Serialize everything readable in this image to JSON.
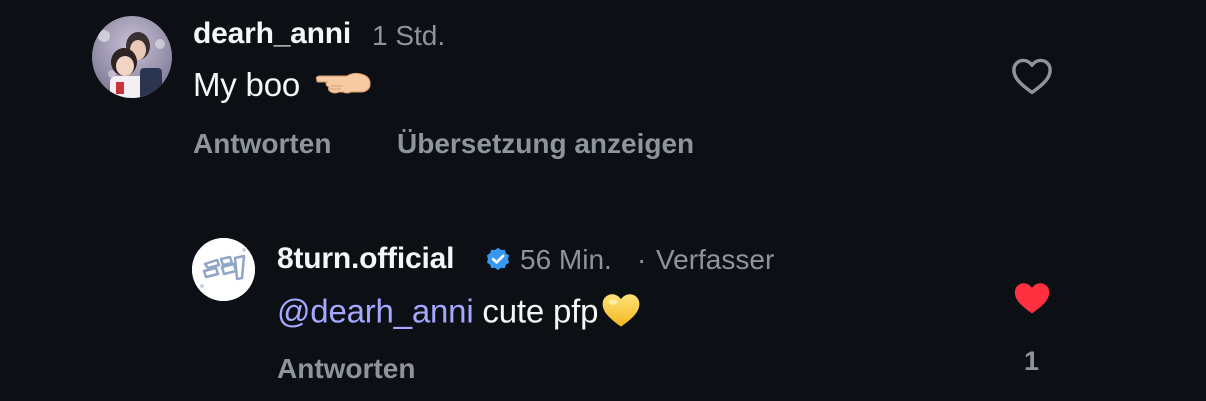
{
  "comments": [
    {
      "username": "dearh_anni",
      "time": "1 Std.",
      "text": "My boo",
      "emoji": "backhand-pointing-left",
      "actions": {
        "reply": "Antworten",
        "translate": "Übersetzung anzeigen"
      },
      "liked": false
    }
  ],
  "reply": {
    "username": "8turn.official",
    "verified": true,
    "time": "56 Min.",
    "separator": "·",
    "author_label": "Verfasser",
    "mention": "@dearh_anni",
    "text": " cute pfp",
    "emoji": "yellow-heart",
    "actions": {
      "reply": "Antworten"
    },
    "liked": true,
    "like_count": "1"
  },
  "colors": {
    "background": "#0c0f14",
    "secondary_text": "#8e949c",
    "mention": "#a5a8ff",
    "liked_heart": "#ff3040",
    "verified_badge": "#3897f0"
  }
}
